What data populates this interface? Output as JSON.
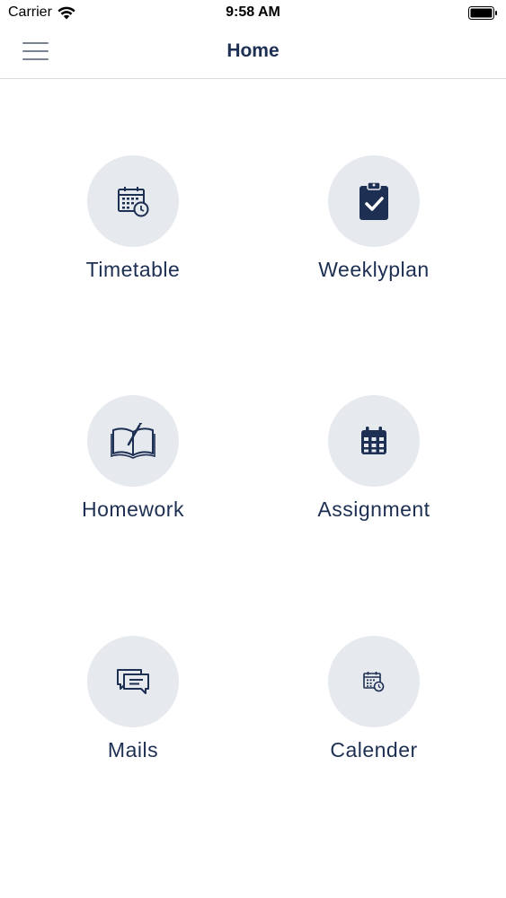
{
  "status_bar": {
    "carrier": "Carrier",
    "time": "9:58 AM"
  },
  "nav": {
    "title": "Home",
    "menu_icon": "hamburger-menu-icon"
  },
  "tiles": [
    {
      "label": "Timetable",
      "icon": "calendar-clock-icon"
    },
    {
      "label": "Weeklyplan",
      "icon": "clipboard-check-icon"
    },
    {
      "label": "Homework",
      "icon": "open-book-pen-icon"
    },
    {
      "label": "Assignment",
      "icon": "calendar-grid-icon"
    },
    {
      "label": "Mails",
      "icon": "chat-bubbles-icon"
    },
    {
      "label": "Calender",
      "icon": "calendar-clock-small-icon"
    }
  ],
  "colors": {
    "primary": "#1d2f52",
    "icon_circle": "#e6e9ee",
    "divider": "#d9dce1",
    "menu_icon": "#7a8393"
  }
}
